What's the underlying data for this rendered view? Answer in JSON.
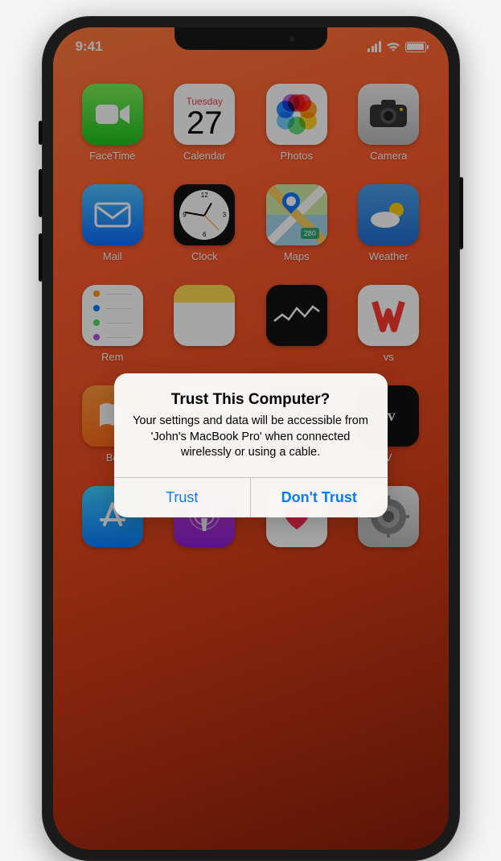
{
  "status": {
    "time": "9:41"
  },
  "calendar": {
    "dow": "Tuesday",
    "day": "27"
  },
  "apps": {
    "facetime": "FaceTime",
    "calendar": "Calendar",
    "photos": "Photos",
    "camera": "Camera",
    "mail": "Mail",
    "clock": "Clock",
    "maps": "Maps",
    "weather": "Weather",
    "reminders": "Rem",
    "notes": "",
    "stocks": "",
    "news": "vs",
    "books": "Bo",
    "tv": "V"
  },
  "maps": {
    "badge": "280"
  },
  "tv": {
    "glyph": "tv"
  },
  "alert": {
    "title": "Trust This Computer?",
    "message": "Your settings and data will be accessible from 'John's MacBook Pro' when connected wirelessly or using a cable.",
    "trust": "Trust",
    "dont_trust": "Don't Trust"
  }
}
